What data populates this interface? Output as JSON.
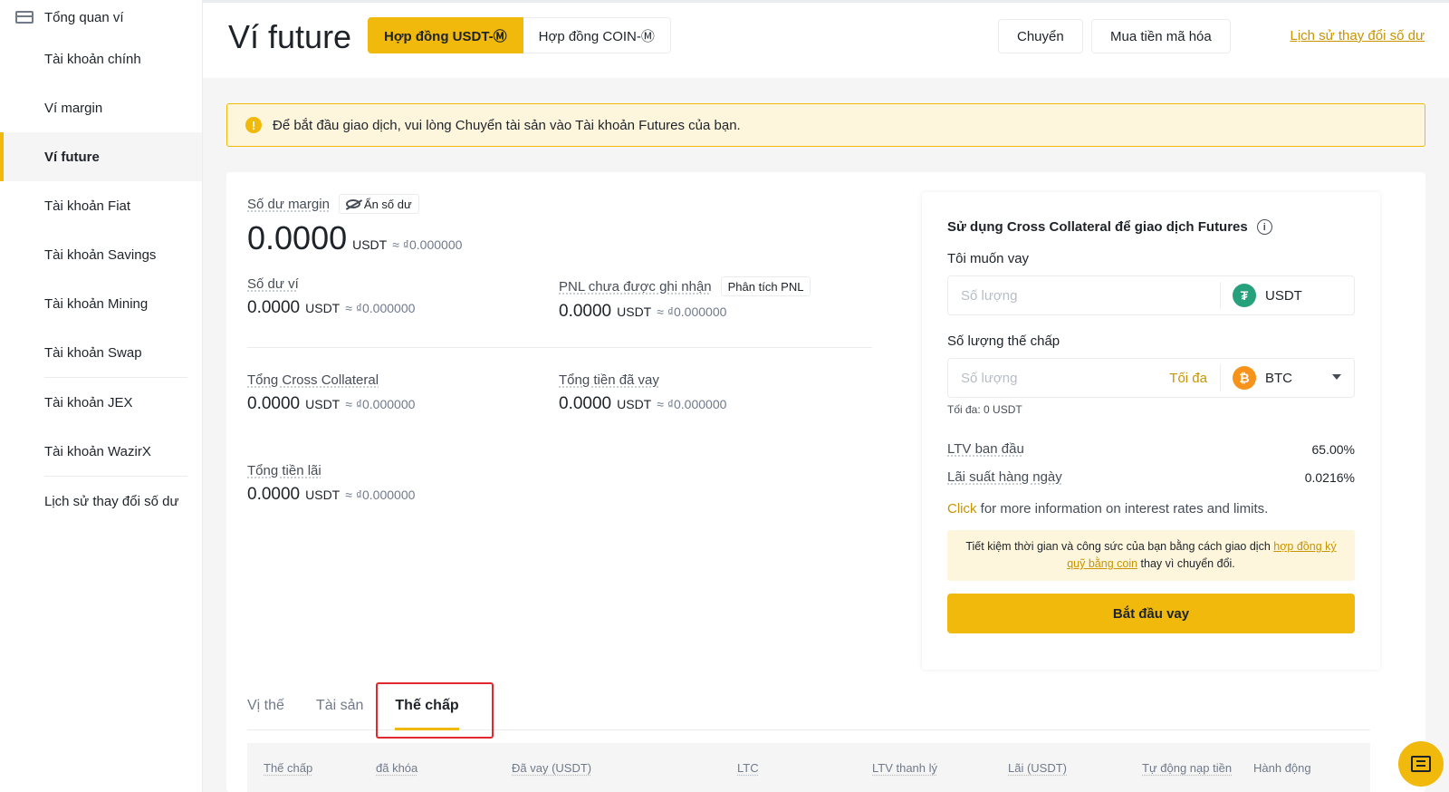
{
  "sidebar": {
    "overview": "Tổng quan ví",
    "items": [
      {
        "label": "Tài khoản chính"
      },
      {
        "label": "Ví margin"
      },
      {
        "label": "Ví future"
      },
      {
        "label": "Tài khoản Fiat"
      },
      {
        "label": "Tài khoản Savings"
      },
      {
        "label": "Tài khoản Mining"
      },
      {
        "label": "Tài khoản Swap"
      },
      {
        "label": "Tài khoản JEX"
      },
      {
        "label": "Tài khoản WazirX"
      },
      {
        "label": "Lịch sử thay đổi số dư"
      }
    ]
  },
  "header": {
    "title": "Ví future",
    "segments": [
      "Hợp đồng USDT-Ⓜ",
      "Hợp đồng COIN-Ⓜ"
    ],
    "transfer": "Chuyển",
    "buy_crypto": "Mua tiền mã hóa",
    "history_link": "Lịch sử thay đổi số dư"
  },
  "notice": {
    "icon": "!",
    "text": "Để bắt đầu giao dịch, vui lòng Chuyển tài sản vào Tài khoản Futures của bạn."
  },
  "balances": {
    "margin_label": "Số dư margin",
    "hide_label": "Ẩn số dư",
    "margin_value": "0.0000",
    "margin_unit": "USDT",
    "margin_fiat": "≈ ₫0.000000",
    "wallet_label": "Số dư ví",
    "wallet_value": "0.0000",
    "wallet_unit": "USDT",
    "wallet_fiat": "≈ ₫0.000000",
    "pnl_label": "PNL chưa được ghi nhận",
    "pnl_btn": "Phân tích PNL",
    "pnl_value": "0.0000",
    "pnl_unit": "USDT",
    "pnl_fiat": "≈ ₫0.000000",
    "cross_label": "Tổng Cross Collateral",
    "cross_value": "0.0000",
    "cross_unit": "USDT",
    "cross_fiat": "≈ ₫0.000000",
    "borrowed_label": "Tổng tiền đã vay",
    "borrowed_value": "0.0000",
    "borrowed_unit": "USDT",
    "borrowed_fiat": "≈ ₫0.000000",
    "interest_label": "Tổng tiền lãi",
    "interest_value": "0.0000",
    "interest_unit": "USDT",
    "interest_fiat": "≈ ₫0.000000"
  },
  "borrow_panel": {
    "title": "Sử dụng Cross Collateral để giao dịch Futures",
    "info_icon": "i",
    "want_label": "Tôi muốn vay",
    "amount_placeholder": "Số lượng",
    "borrow_coin": "USDT",
    "borrow_coin_symbol": "₮",
    "collateral_label": "Số lượng thế chấp",
    "collateral_placeholder": "Số lượng",
    "max_link": "Tối đa",
    "collateral_coin": "BTC",
    "collateral_coin_symbol": "₿",
    "max_hint": "Tối đa: 0 USDT",
    "ltv_label": "LTV ban đầu",
    "ltv_value": "65.00%",
    "rate_label": "Lãi suất hàng ngày",
    "rate_value": "0.0216%",
    "more_click": "Click",
    "more_text": " for more information on interest rates and limits.",
    "promo_text": "Tiết kiệm thời gian và công sức của bạn bằng cách giao dịch ",
    "promo_link": "hợp đồng ký quỹ bằng coin",
    "promo_tail": " thay vì chuyển đổi.",
    "start_btn": "Bắt đầu vay"
  },
  "tabs": [
    "Vị thế",
    "Tài sản",
    "Thế chấp"
  ],
  "table": {
    "headers": [
      "Thế chấp",
      "đã khóa",
      "Đã vay (USDT)",
      "LTC",
      "LTV thanh lý",
      "Lãi (USDT)",
      "Tự động nạp tiền",
      "Hành động"
    ]
  },
  "colors": {
    "accent": "#f0b90b",
    "link": "#c99400",
    "highlight": "#e0282e",
    "tether": "#26a17b",
    "bitcoin": "#f7931a"
  }
}
